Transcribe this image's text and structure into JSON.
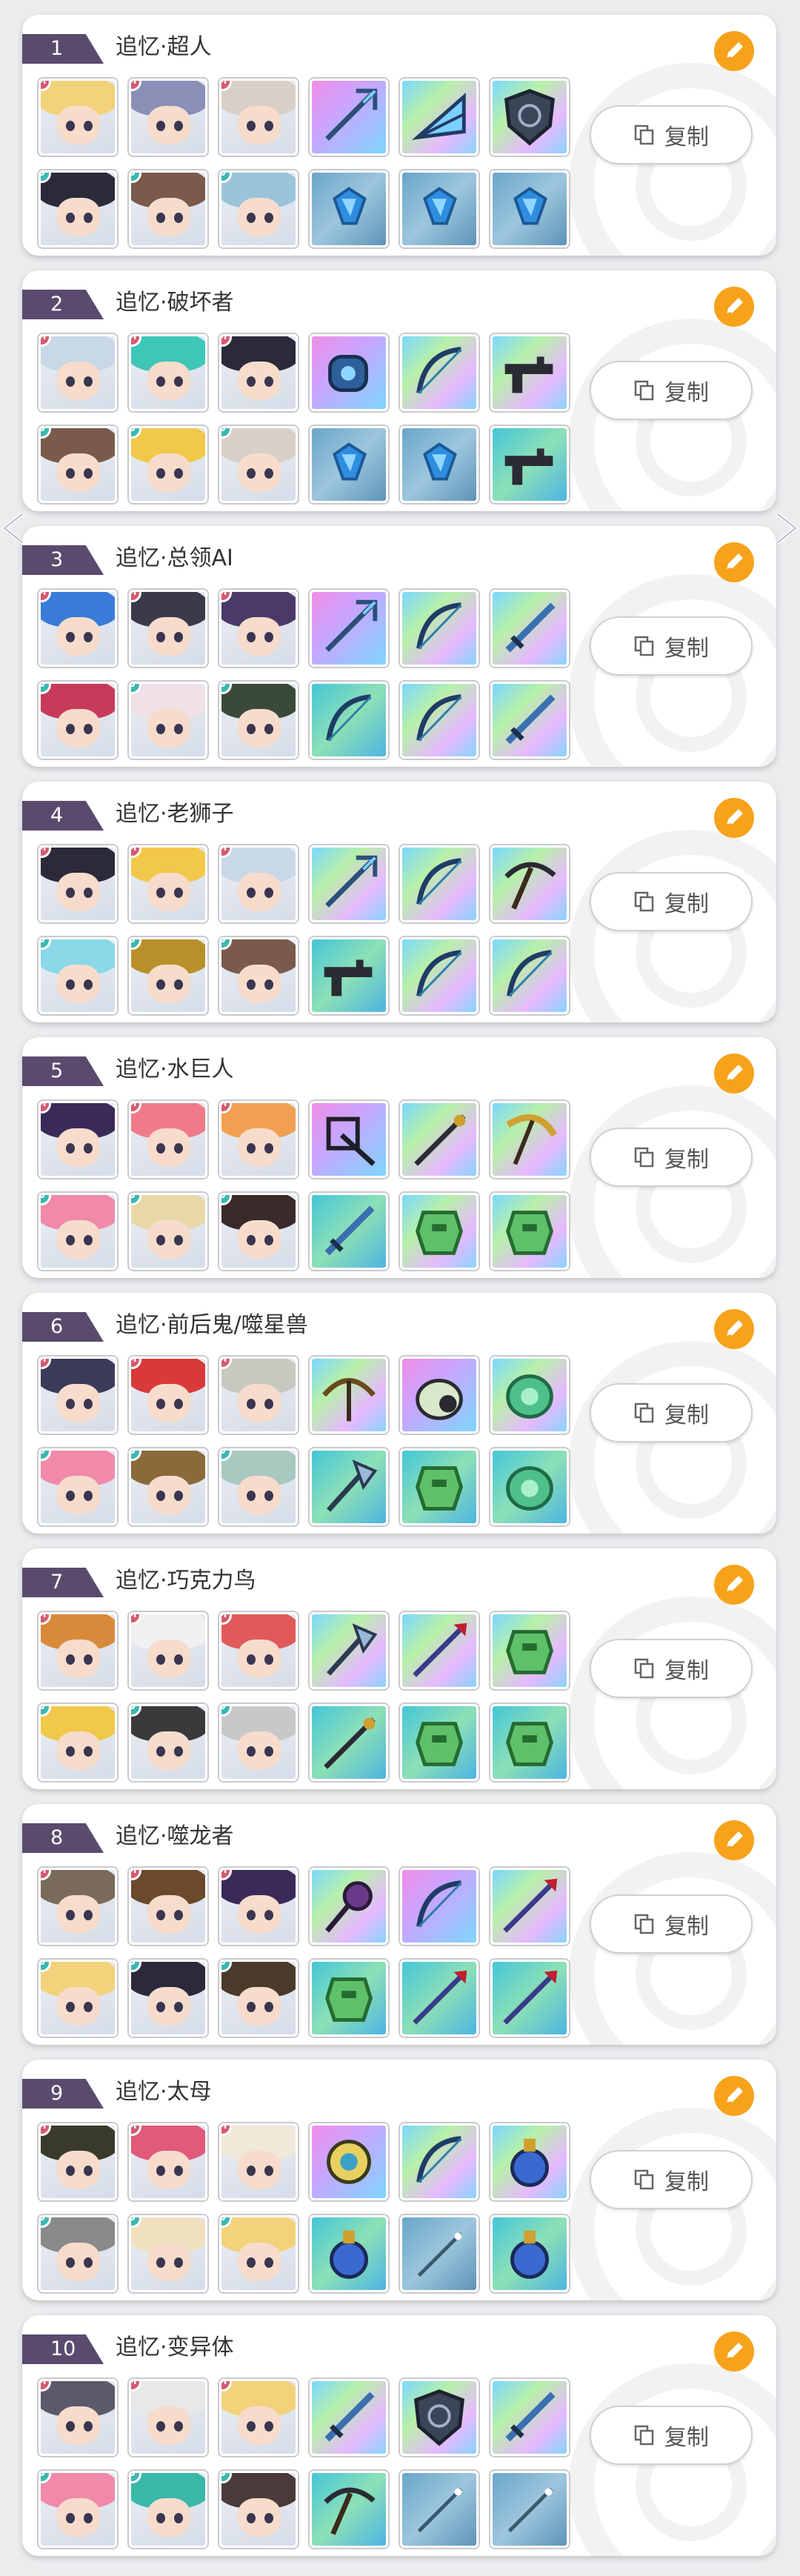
{
  "accent_color": "#f7a21b",
  "rank_color": "#5a4b6e",
  "badge_m_color": "#d45a71",
  "badge_u_color": "#3bb8b0",
  "copy_label": "复制",
  "nav": {
    "prev_icon": "chevron-left-icon",
    "next_icon": "chevron-right-icon"
  },
  "teams": [
    {
      "rank": "1",
      "title": "追忆·超人",
      "heroes_top": [
        {
          "badge": "M",
          "hair": "#f2d27a"
        },
        {
          "badge": "M",
          "hair": "#8a8fb8"
        },
        {
          "badge": "M",
          "hair": "#d8d0c8"
        }
      ],
      "items_top": [
        {
          "bg": "pink",
          "icon": "trident-icon"
        },
        {
          "bg": "rainbow",
          "icon": "fan-icon"
        },
        {
          "bg": "rainbow",
          "icon": "shield-icon"
        }
      ],
      "heroes_bottom": [
        {
          "badge": "U",
          "hair": "#2a2a3a"
        },
        {
          "badge": "U",
          "hair": "#7a5a4a"
        },
        {
          "badge": "U",
          "hair": "#9ac4d8"
        }
      ],
      "items_bottom": [
        {
          "bg": "blue",
          "icon": "crystal-icon"
        },
        {
          "bg": "blue",
          "icon": "crystal-icon"
        },
        {
          "bg": "blue",
          "icon": "crystal-icon"
        }
      ]
    },
    {
      "rank": "2",
      "title": "追忆·破坏者",
      "heroes_top": [
        {
          "badge": "M",
          "hair": "#c8d8e8"
        },
        {
          "badge": "M",
          "hair": "#3ec7b8"
        },
        {
          "badge": "M",
          "hair": "#2a2a3a"
        }
      ],
      "items_top": [
        {
          "bg": "pink",
          "icon": "gauntlet-icon"
        },
        {
          "bg": "rainbow",
          "icon": "bow-icon"
        },
        {
          "bg": "rainbow",
          "icon": "gun-icon"
        }
      ],
      "heroes_bottom": [
        {
          "badge": "U",
          "hair": "#7a5a4a"
        },
        {
          "badge": "U",
          "hair": "#f2c84a"
        },
        {
          "badge": "U",
          "hair": "#d8d0c8"
        }
      ],
      "items_bottom": [
        {
          "bg": "blue",
          "icon": "crystal-icon"
        },
        {
          "bg": "blue",
          "icon": "crystal-icon"
        },
        {
          "bg": "teal",
          "icon": "gun-icon"
        }
      ]
    },
    {
      "rank": "3",
      "title": "追忆·总领AI",
      "heroes_top": [
        {
          "badge": "M",
          "hair": "#3a7ad8"
        },
        {
          "badge": "M",
          "hair": "#3a3a4a"
        },
        {
          "badge": "M",
          "hair": "#4a3a6a"
        }
      ],
      "items_top": [
        {
          "bg": "pink",
          "icon": "trident-icon"
        },
        {
          "bg": "rainbow",
          "icon": "bow-icon"
        },
        {
          "bg": "rainbow",
          "icon": "sword-icon"
        }
      ],
      "heroes_bottom": [
        {
          "badge": "U",
          "hair": "#c83a5a"
        },
        {
          "badge": "U",
          "hair": "#f0e0e8"
        },
        {
          "badge": "U",
          "hair": "#3a4a3a"
        }
      ],
      "items_bottom": [
        {
          "bg": "teal",
          "icon": "bow-icon"
        },
        {
          "bg": "rainbow",
          "icon": "bow-icon"
        },
        {
          "bg": "rainbow",
          "icon": "sword-icon"
        }
      ]
    },
    {
      "rank": "4",
      "title": "追忆·老狮子",
      "heroes_top": [
        {
          "badge": "M",
          "hair": "#2a2a3a"
        },
        {
          "badge": "M",
          "hair": "#f2c84a"
        },
        {
          "badge": "M",
          "hair": "#c8d8e8"
        }
      ],
      "items_top": [
        {
          "bg": "rainbow",
          "icon": "trident-icon"
        },
        {
          "bg": "rainbow",
          "icon": "bow-icon"
        },
        {
          "bg": "rainbow",
          "icon": "pickaxe-icon"
        }
      ],
      "heroes_bottom": [
        {
          "badge": "U",
          "hair": "#8ad8e8"
        },
        {
          "badge": "U",
          "hair": "#b8902a"
        },
        {
          "badge": "U",
          "hair": "#7a5a4a"
        }
      ],
      "items_bottom": [
        {
          "bg": "teal",
          "icon": "gun-icon"
        },
        {
          "bg": "rainbow",
          "icon": "bow-icon"
        },
        {
          "bg": "rainbow",
          "icon": "bow-icon"
        }
      ]
    },
    {
      "rank": "5",
      "title": "追忆·水巨人",
      "heroes_top": [
        {
          "badge": "M",
          "hair": "#3a2a5a"
        },
        {
          "badge": "M",
          "hair": "#f07a8a"
        },
        {
          "badge": "M",
          "hair": "#f0a050"
        }
      ],
      "items_top": [
        {
          "bg": "pink",
          "icon": "weapon-icon"
        },
        {
          "bg": "rainbow",
          "icon": "staff-icon"
        },
        {
          "bg": "rainbow",
          "icon": "scythe-icon"
        }
      ],
      "heroes_bottom": [
        {
          "badge": "U",
          "hair": "#f08aa8"
        },
        {
          "badge": "U",
          "hair": "#e8d8a8"
        },
        {
          "badge": "U",
          "hair": "#3a2a2a"
        }
      ],
      "items_bottom": [
        {
          "bg": "teal",
          "icon": "sword-icon"
        },
        {
          "bg": "rainbow",
          "icon": "armor-icon"
        },
        {
          "bg": "rainbow",
          "icon": "armor-icon"
        }
      ]
    },
    {
      "rank": "6",
      "title": "追忆·前后鬼/噬星兽",
      "heroes_top": [
        {
          "badge": "M",
          "hair": "#3a3a5a"
        },
        {
          "badge": "M",
          "hair": "#d83a3a"
        },
        {
          "badge": "M",
          "hair": "#c8c8c0"
        }
      ],
      "items_top": [
        {
          "bg": "rainbow",
          "icon": "crossbow-icon"
        },
        {
          "bg": "pink",
          "icon": "pouch-icon"
        },
        {
          "bg": "rainbow",
          "icon": "gem-icon"
        }
      ],
      "heroes_bottom": [
        {
          "badge": "U",
          "hair": "#f08aa8"
        },
        {
          "badge": "U",
          "hair": "#8a6a3a"
        },
        {
          "badge": "U",
          "hair": "#a8c8c0"
        }
      ],
      "items_bottom": [
        {
          "bg": "teal",
          "icon": "axe-icon"
        },
        {
          "bg": "teal",
          "icon": "armor-icon"
        },
        {
          "bg": "teal",
          "icon": "gem-icon"
        }
      ]
    },
    {
      "rank": "7",
      "title": "追忆·巧克力鸟",
      "heroes_top": [
        {
          "badge": "M",
          "hair": "#d88a3a"
        },
        {
          "badge": "M",
          "hair": "#f0f0f0"
        },
        {
          "badge": "M",
          "hair": "#e05a5a"
        }
      ],
      "items_top": [
        {
          "bg": "rainbow",
          "icon": "axe-icon"
        },
        {
          "bg": "rainbow",
          "icon": "spear-icon"
        },
        {
          "bg": "rainbow",
          "icon": "armor-icon"
        }
      ],
      "heroes_bottom": [
        {
          "badge": "U",
          "hair": "#f2c84a"
        },
        {
          "badge": "U",
          "hair": "#3a3a3a"
        },
        {
          "badge": "U",
          "hair": "#c8c8c8"
        }
      ],
      "items_bottom": [
        {
          "bg": "teal",
          "icon": "staff-icon"
        },
        {
          "bg": "teal",
          "icon": "armor-icon"
        },
        {
          "bg": "teal",
          "icon": "armor-icon"
        }
      ]
    },
    {
      "rank": "8",
      "title": "追忆·噬龙者",
      "heroes_top": [
        {
          "badge": "M",
          "hair": "#7a6a5a"
        },
        {
          "badge": "M",
          "hair": "#6a4a2a"
        },
        {
          "badge": "M",
          "hair": "#3a2a5a"
        }
      ],
      "items_top": [
        {
          "bg": "rainbow",
          "icon": "mace-icon"
        },
        {
          "bg": "pink",
          "icon": "bow-icon"
        },
        {
          "bg": "rainbow",
          "icon": "spear-icon"
        }
      ],
      "heroes_bottom": [
        {
          "badge": "U",
          "hair": "#f2d27a"
        },
        {
          "badge": "U",
          "hair": "#2a2a3a"
        },
        {
          "badge": "U",
          "hair": "#4a3a2a"
        }
      ],
      "items_bottom": [
        {
          "bg": "teal",
          "icon": "armor-icon"
        },
        {
          "bg": "teal",
          "icon": "spear-icon"
        },
        {
          "bg": "teal",
          "icon": "spear-icon"
        }
      ]
    },
    {
      "rank": "9",
      "title": "追忆·太母",
      "heroes_top": [
        {
          "badge": "M",
          "hair": "#3a3a2a"
        },
        {
          "badge": "M",
          "hair": "#e05a7a"
        },
        {
          "badge": "M",
          "hair": "#f0e8d8"
        }
      ],
      "items_top": [
        {
          "bg": "pink",
          "icon": "amulet-icon"
        },
        {
          "bg": "rainbow",
          "icon": "bow-icon"
        },
        {
          "bg": "rainbow",
          "icon": "potion-icon"
        }
      ],
      "heroes_bottom": [
        {
          "badge": "U",
          "hair": "#8a8a8a"
        },
        {
          "badge": "U",
          "hair": "#f0e0c0"
        },
        {
          "badge": "U",
          "hair": "#f2d27a"
        }
      ],
      "items_bottom": [
        {
          "bg": "teal",
          "icon": "potion-icon"
        },
        {
          "bg": "blue",
          "icon": "needle-icon"
        },
        {
          "bg": "teal",
          "icon": "potion-icon"
        }
      ]
    },
    {
      "rank": "10",
      "title": "追忆·变异体",
      "heroes_top": [
        {
          "badge": "M",
          "hair": "#5a5a6a"
        },
        {
          "badge": "M",
          "hair": "#e8e8e8"
        },
        {
          "badge": "M",
          "hair": "#f2d27a"
        }
      ],
      "items_top": [
        {
          "bg": "rainbow",
          "icon": "sword-icon"
        },
        {
          "bg": "rainbow",
          "icon": "shield-icon"
        },
        {
          "bg": "rainbow",
          "icon": "sword-icon"
        }
      ],
      "heroes_bottom": [
        {
          "badge": "U",
          "hair": "#f08aa8"
        },
        {
          "badge": "U",
          "hair": "#3ab8a8"
        },
        {
          "badge": "U",
          "hair": "#4a3a3a"
        }
      ],
      "items_bottom": [
        {
          "bg": "teal",
          "icon": "pickaxe-icon"
        },
        {
          "bg": "blue",
          "icon": "needle-icon"
        },
        {
          "bg": "blue",
          "icon": "needle-icon"
        }
      ]
    }
  ]
}
